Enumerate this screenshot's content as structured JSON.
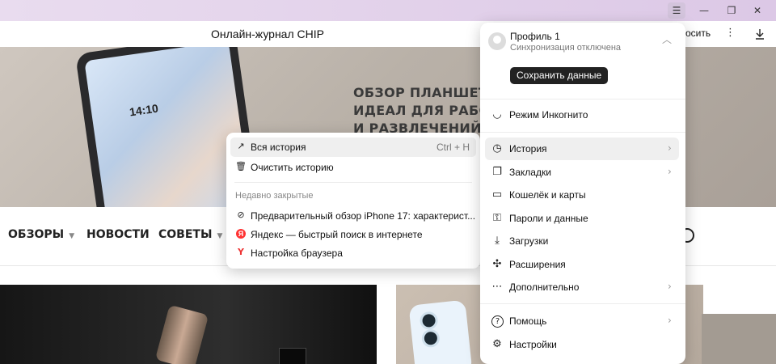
{
  "window": {
    "menu_glyph": "☰",
    "minimize": "—",
    "restore": "❐",
    "close": "✕"
  },
  "tab": {
    "title": "Онлайн-журнал CHIP",
    "partial_button": "осить",
    "more": "⋮",
    "download_icon": "download-icon"
  },
  "hero": {
    "lines": [
      "ОБЗОР ПЛАНШЕТА НО",
      "ИДЕАЛ ДЛЯ РАБОТЫ",
      "И РАЗВЛЕЧЕНИЙ"
    ],
    "tablet_time": "14:10"
  },
  "site_nav": [
    {
      "label": "ОБЗОРЫ",
      "caret": "▼"
    },
    {
      "label": "НОВОСТИ",
      "caret": ""
    },
    {
      "label": "СОВЕТЫ",
      "caret": "▼"
    }
  ],
  "menu": {
    "profile_name": "Профиль 1",
    "sync_status": "Синхронизация отключена",
    "chevron": "︿",
    "save_button": "Сохранить данные",
    "items": [
      {
        "label": "Режим Инкогнито",
        "icon": "incognito-icon",
        "glyph": "◡",
        "arrow": ""
      },
      {
        "label": "История",
        "icon": "history-icon",
        "glyph": "◷",
        "arrow": "›",
        "active": true
      },
      {
        "label": "Закладки",
        "icon": "bookmarks-icon",
        "glyph": "❐",
        "arrow": "›"
      },
      {
        "label": "Кошелёк и карты",
        "icon": "wallet-icon",
        "glyph": "▭",
        "arrow": ""
      },
      {
        "label": "Пароли и данные",
        "icon": "passwords-icon",
        "glyph": "⚿",
        "arrow": ""
      },
      {
        "label": "Загрузки",
        "icon": "downloads-icon",
        "glyph": "⤓",
        "arrow": ""
      },
      {
        "label": "Расширения",
        "icon": "extensions-icon",
        "glyph": "✣",
        "arrow": ""
      },
      {
        "label": "Дополнительно",
        "icon": "more-icon",
        "glyph": "⋯",
        "arrow": "›"
      },
      {
        "label": "Помощь",
        "icon": "help-icon",
        "glyph": "?",
        "arrow": "›"
      },
      {
        "label": "Настройки",
        "icon": "settings-icon",
        "glyph": "⚙",
        "arrow": ""
      }
    ]
  },
  "history_submenu": {
    "all_history": "Вся история",
    "all_history_shortcut": "Ctrl + H",
    "clear_history": "Очистить историю",
    "recently_closed_heading": "Недавно закрытые",
    "recent": [
      {
        "title": "Предварительный обзор iPhone 17: характерист...",
        "icon": "site-favicon-icon",
        "glyph": "⊘"
      },
      {
        "title": "Яндекс — быстрый поиск в интернете",
        "icon": "yandex-search-icon",
        "glyph": "Я"
      },
      {
        "title": "Настройка браузера",
        "icon": "yandex-browser-icon",
        "glyph": "Y"
      }
    ]
  }
}
